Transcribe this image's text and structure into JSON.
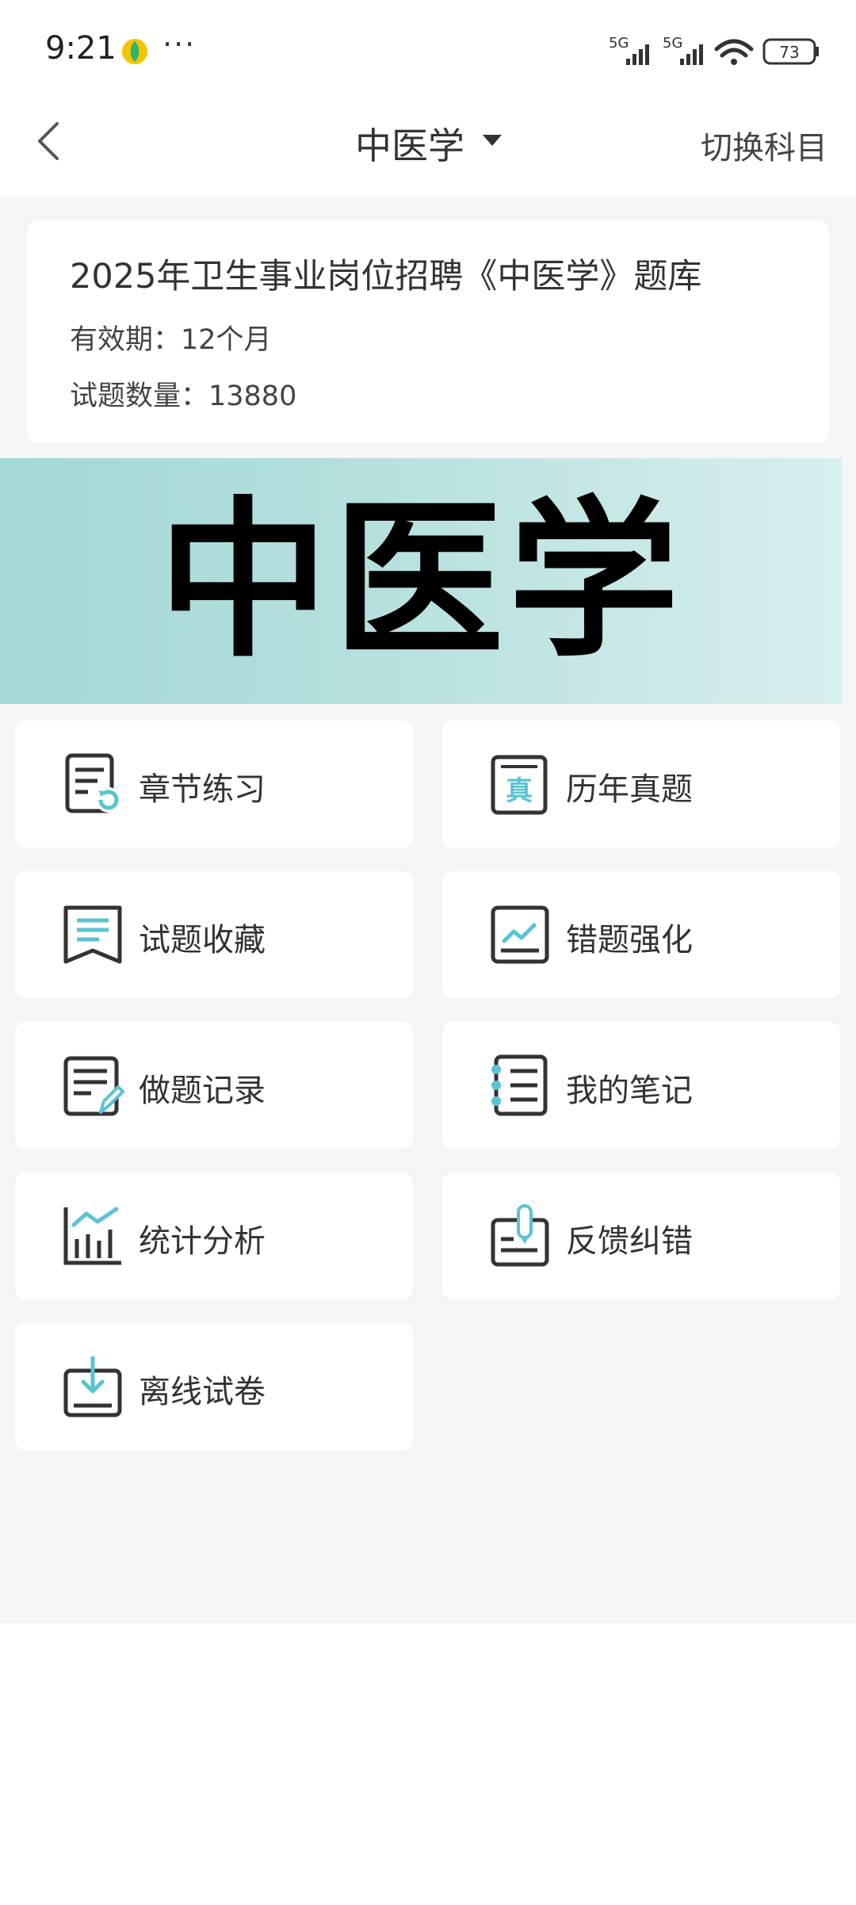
{
  "status_bar": {
    "time": "9:21",
    "more": "···",
    "battery": "73",
    "signal_1": "5G",
    "signal_2": "5G"
  },
  "nav": {
    "title": "中医学",
    "switch_label": "切换科目",
    "back_icon": "chevron-left-icon",
    "caret_icon": "caret-down-icon"
  },
  "info": {
    "title": "2025年卫生事业岗位招聘《中医学》题库",
    "validity": "有效期：12个月",
    "question_count": "试题数量：13880"
  },
  "banner": {
    "text": "中医学"
  },
  "menu": [
    {
      "label": "章节练习",
      "icon": "chapter-practice-icon"
    },
    {
      "label": "历年真题",
      "icon": "past-exams-icon"
    },
    {
      "label": "试题收藏",
      "icon": "bookmark-icon"
    },
    {
      "label": "错题强化",
      "icon": "wrong-questions-icon"
    },
    {
      "label": "做题记录",
      "icon": "practice-record-icon"
    },
    {
      "label": "我的笔记",
      "icon": "notes-icon"
    },
    {
      "label": "统计分析",
      "icon": "statistics-icon"
    },
    {
      "label": "反馈纠错",
      "icon": "feedback-icon"
    },
    {
      "label": "离线试卷",
      "icon": "offline-download-icon"
    }
  ],
  "colors": {
    "accent": "#5ac3d2",
    "icon_stroke": "#333333",
    "background": "#f5f5f5"
  }
}
